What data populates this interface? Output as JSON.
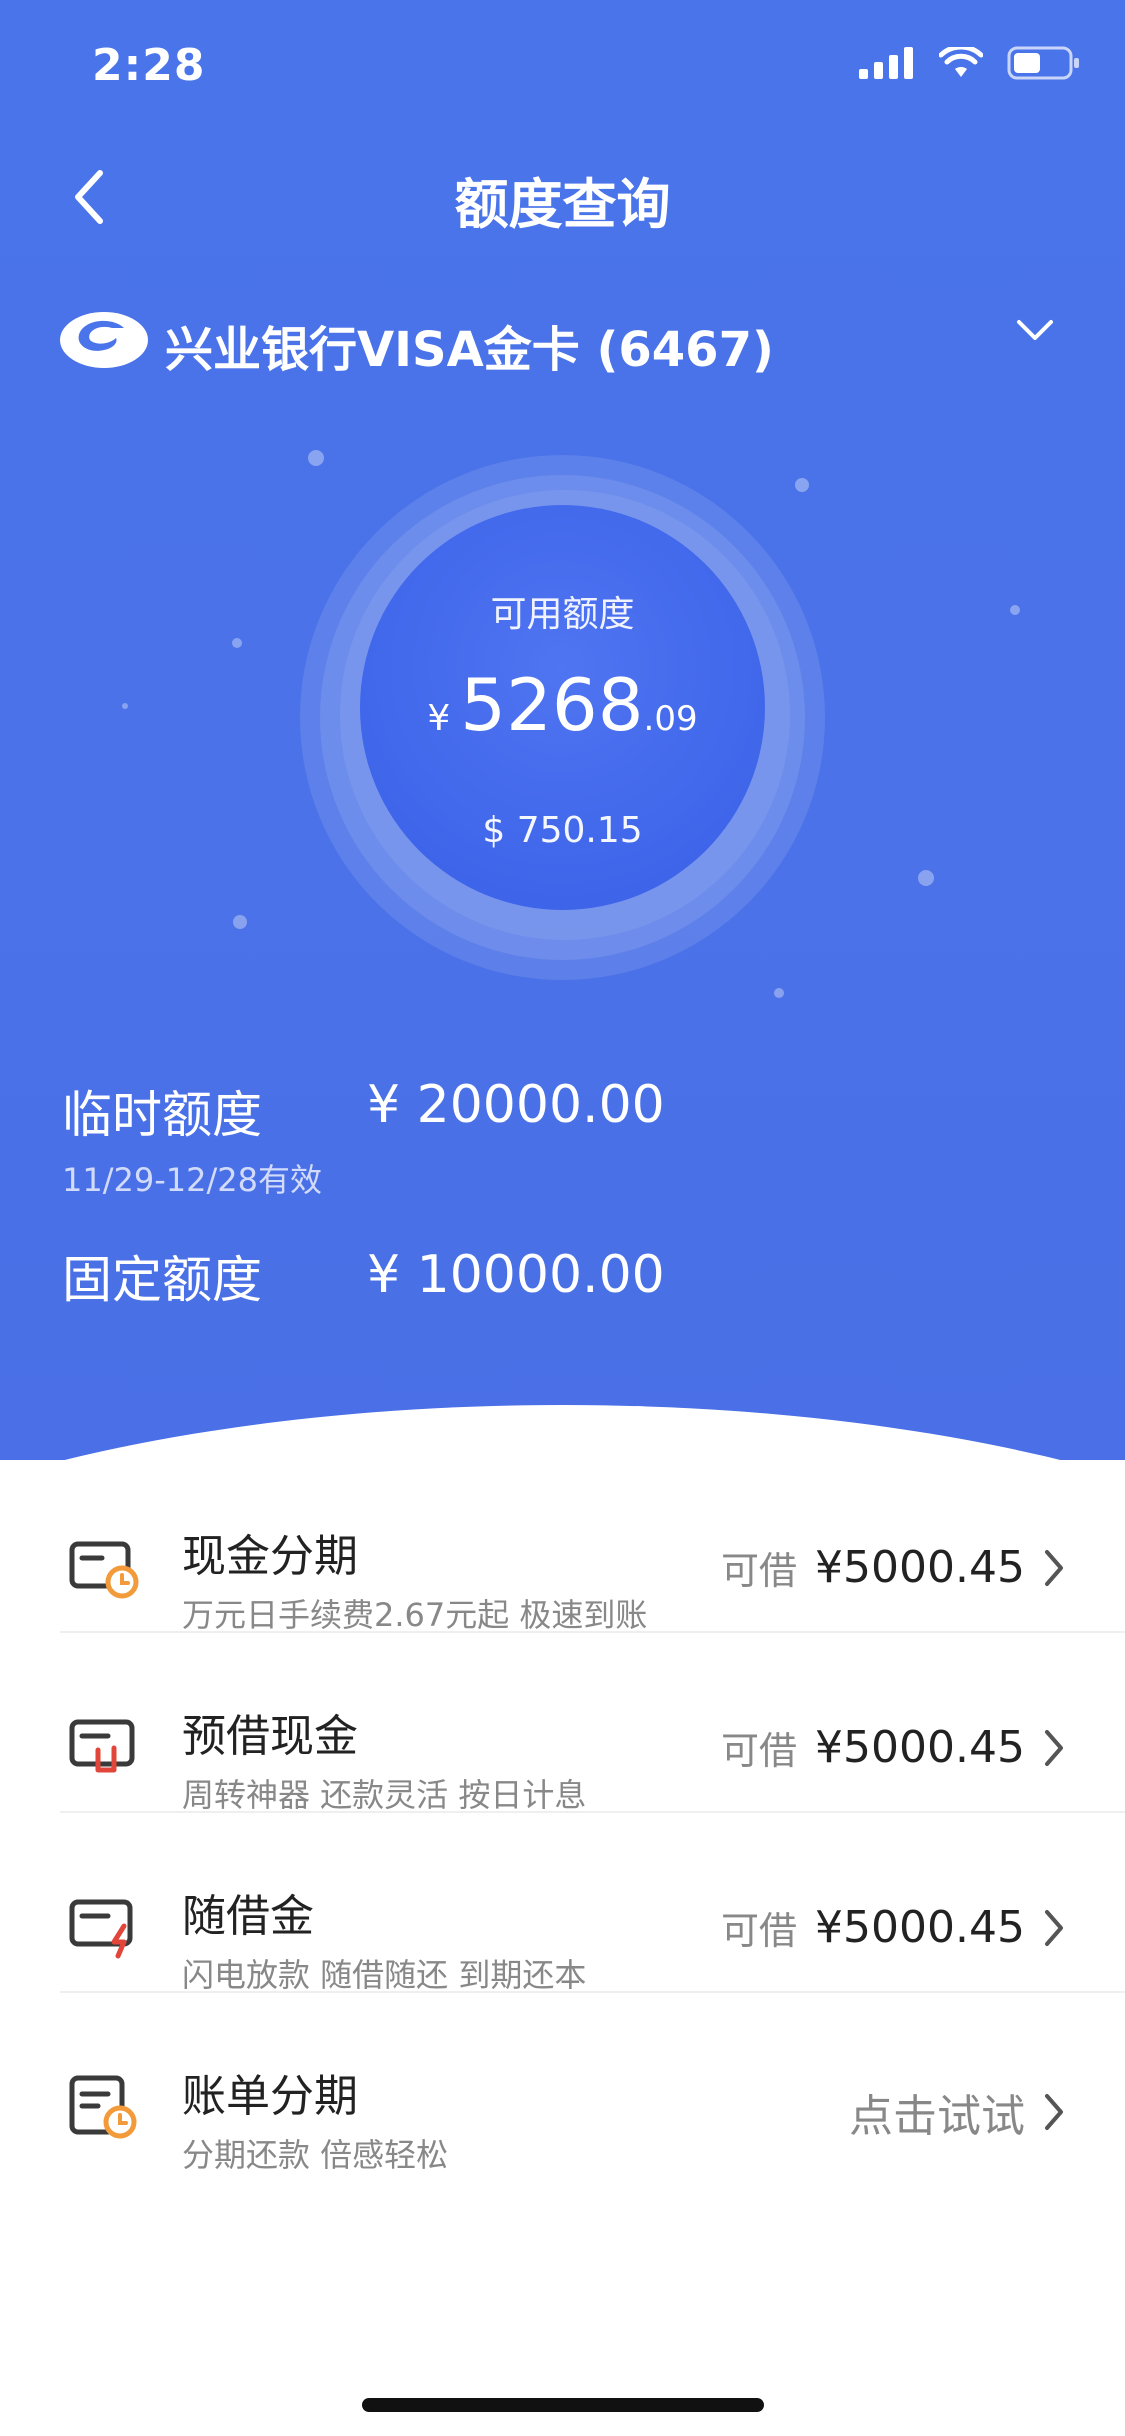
{
  "status": {
    "time": "2:28"
  },
  "nav": {
    "title": "额度查询"
  },
  "card": {
    "name": "兴业银行VISA金卡 (6467)"
  },
  "available": {
    "label": "可用额度",
    "currency": "¥",
    "integer": "5268",
    "decimal": ".09",
    "usd": "$ 750.15"
  },
  "limits": {
    "temp": {
      "label": "临时额度",
      "value": "¥ 20000.00",
      "validity": "11/29-12/28有效"
    },
    "fixed": {
      "label": "固定额度",
      "value": "¥ 10000.00"
    }
  },
  "items": [
    {
      "title": "现金分期",
      "desc": "万元日手续费2.67元起 极速到账",
      "prefix": "可借",
      "value": "¥5000.45",
      "icon": "card-clock-icon"
    },
    {
      "title": "预借现金",
      "desc": "周转神器 还款灵活 按日计息",
      "prefix": "可借",
      "value": "¥5000.45",
      "icon": "card-cash-icon"
    },
    {
      "title": "随借金",
      "desc": "闪电放款 随借随还 到期还本",
      "prefix": "可借",
      "value": "¥5000.45",
      "icon": "card-lightning-icon"
    },
    {
      "title": "账单分期",
      "desc": "分期还款 倍感轻松",
      "action": "点击试试",
      "icon": "bill-clock-icon"
    }
  ],
  "colors": {
    "primary": "#4a74ea",
    "accent": "#f39a3b",
    "red": "#e2463a"
  }
}
